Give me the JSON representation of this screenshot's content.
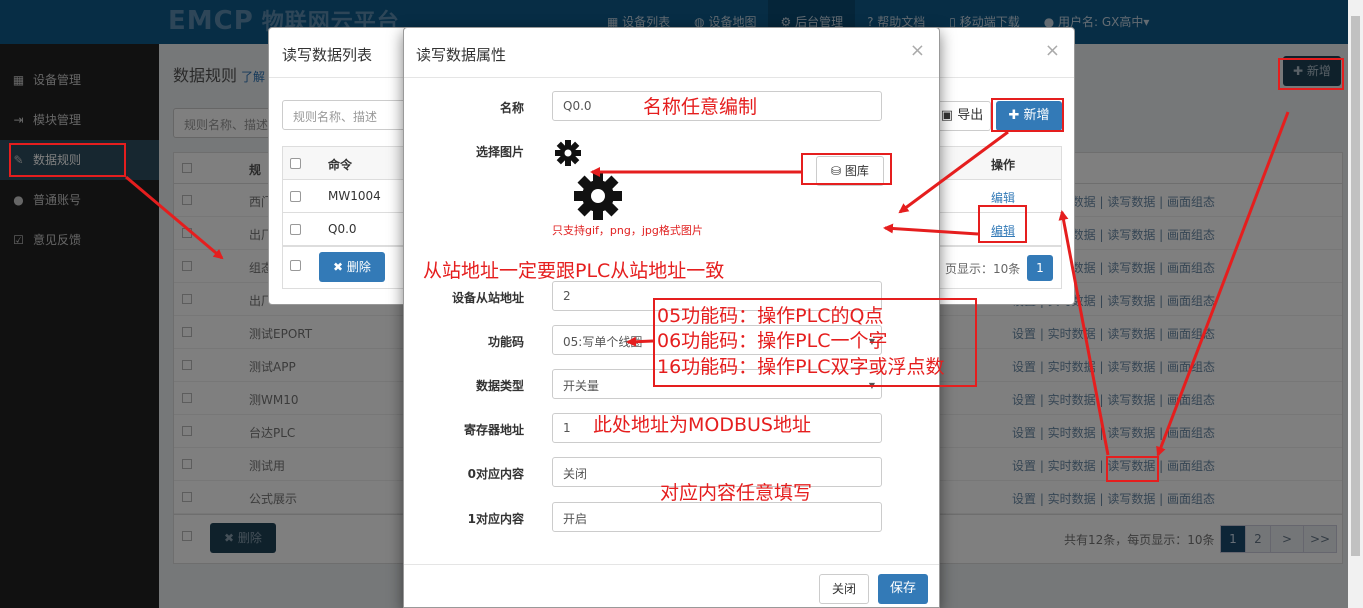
{
  "topbar": {
    "logo": "EMCP",
    "logo_sub": "物联网云平台",
    "nav": [
      "设备列表",
      "设备地图",
      "后台管理",
      "帮助文档",
      "移动端下载",
      "用户名: GX高中"
    ]
  },
  "sidebar": {
    "items": [
      {
        "label": "设备管理",
        "icon": "grid-icon"
      },
      {
        "label": "模块管理",
        "icon": "signin-icon"
      },
      {
        "label": "数据规则",
        "icon": "pencil-icon"
      },
      {
        "label": "普通账号",
        "icon": "user-icon"
      },
      {
        "label": "意见反馈",
        "icon": "edit-icon"
      }
    ]
  },
  "main": {
    "title": "数据规则",
    "learn_more": "了解",
    "search_placeholder": "规则名称、描述",
    "new_button": "新增",
    "rows": [
      {
        "name": "规",
        "ops": ""
      },
      {
        "name": "西门",
        "ops": "设置 | 实时数据 | 读写数据 | 画面组态"
      },
      {
        "name": "出厂",
        "ops": "设置 | 实时数据 | 读写数据 | 画面组态"
      },
      {
        "name": "组态",
        "ops": "设置 | 实时数据 | 读写数据 | 画面组态"
      },
      {
        "name": "出厂",
        "ops": "设置 | 实时数据 | 读写数据 | 画面组态"
      },
      {
        "name": "测试EPORT",
        "ops": "设置 | 实时数据 | 读写数据 | 画面组态"
      },
      {
        "name": "测试APP",
        "ops": "设置 | 实时数据 | 读写数据 | 画面组态"
      },
      {
        "name": "测WM10",
        "ops": "设置 | 实时数据 | 读写数据 | 画面组态"
      },
      {
        "name": "台达PLC",
        "ops": "设置 | 实时数据 | 读写数据 | 画面组态"
      },
      {
        "name": "测试用",
        "ops": "设置 | 实时数据 | 读写数据 | 画面组态"
      },
      {
        "name": "公式展示",
        "ops": "设置 | 实时数据 | 读写数据 | 画面组态"
      }
    ],
    "delete_button": "删除",
    "page_info": "共有12条，每页显示：10条",
    "pages": [
      "1",
      "2",
      ">",
      ">>"
    ]
  },
  "modal_list": {
    "title": "读写数据列表",
    "search_placeholder": "规则名称、描述",
    "export_button": "导出",
    "new_button": "新增",
    "col_command": "命令",
    "col_ops": "操作",
    "rows": [
      {
        "command": "MW1004",
        "op": "编辑"
      },
      {
        "command": "Q0.0",
        "op": "编辑"
      }
    ],
    "delete_button": "删除",
    "page_info": "页显示：10条",
    "page": "1",
    "close": "×"
  },
  "modal_attr": {
    "title": "读写数据属性",
    "close": "×",
    "fields": {
      "name_label": "名称",
      "name_value": "Q0.0",
      "image_label": "选择图片",
      "library_button": "图库",
      "image_hint": "只支持gif，png，jpg格式图片",
      "slave_label": "设备从站地址",
      "slave_value": "2",
      "func_label": "功能码",
      "func_value": "05:写单个线圈",
      "type_label": "数据类型",
      "type_value": "开关量",
      "reg_label": "寄存器地址",
      "reg_value": "1",
      "zero_label": "0对应内容",
      "zero_value": "关闭",
      "one_label": "1对应内容",
      "one_value": "开启"
    },
    "close_button": "关闭",
    "save_button": "保存"
  },
  "annotations": {
    "name": "名称任意编制",
    "slave": "从站地址一定要跟PLC从站地址一致",
    "func_05": "05功能码：操作PLC的Q点",
    "func_06": "06功能码：操作PLC一个字",
    "func_16": "16功能码：操作PLC双字或浮点数",
    "modbus": "此处地址为MODBUS地址",
    "content": "对应内容任意填写"
  },
  "colors": {
    "annotation": "#e51e1e",
    "primary": "#337ab7",
    "topbar": "#0e5a8a",
    "sidebar": "#222222"
  }
}
